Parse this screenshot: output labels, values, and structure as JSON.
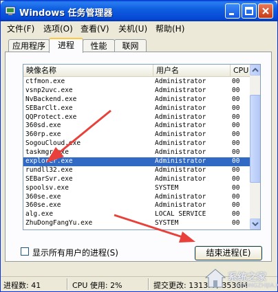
{
  "window": {
    "title": "Windows 任务管理器"
  },
  "menu": [
    "文件(F)",
    "选项(O)",
    "查看(V)",
    "关机(U)",
    "帮助(H)"
  ],
  "tabs": [
    "应用程序",
    "进程",
    "性能",
    "联网"
  ],
  "active_tab": "进程",
  "columns": [
    "映像名称",
    "用户名",
    "CPU"
  ],
  "processes": [
    {
      "name": "ctfmon.exe",
      "user": "Administrator",
      "cpu": "00"
    },
    {
      "name": "vsnp2uvc.exe",
      "user": "Administrator",
      "cpu": "00"
    },
    {
      "name": "NvBackend.exe",
      "user": "Administrator",
      "cpu": "00"
    },
    {
      "name": "SEBarClt.exe",
      "user": "Administrator",
      "cpu": "00"
    },
    {
      "name": "QQProtect.exe",
      "user": "Administrator",
      "cpu": "00"
    },
    {
      "name": "360sd.exe",
      "user": "Administrator",
      "cpu": "00"
    },
    {
      "name": "360rp.exe",
      "user": "Administrator",
      "cpu": "00"
    },
    {
      "name": "SogouCloud.exe",
      "user": "Administrator",
      "cpu": "00"
    },
    {
      "name": "taskmgr.exe",
      "user": "Administrator",
      "cpu": "00"
    },
    {
      "name": "explorer.exe",
      "user": "Administrator",
      "cpu": "00"
    },
    {
      "name": "rundll32.exe",
      "user": "Administrator",
      "cpu": "00"
    },
    {
      "name": "SEBarSvr.exe",
      "user": "Administrator",
      "cpu": "00"
    },
    {
      "name": "spoolsv.exe",
      "user": "SYSTEM",
      "cpu": "00"
    },
    {
      "name": "360se.exe",
      "user": "Administrator",
      "cpu": "00"
    },
    {
      "name": "360se.exe",
      "user": "Administrator",
      "cpu": "00"
    },
    {
      "name": "alg.exe",
      "user": "LOCAL SERVICE",
      "cpu": "00"
    },
    {
      "name": "ZhuDongFangYu.exe",
      "user": "SYSTEM",
      "cpu": "00"
    }
  ],
  "selected_process": "explorer.exe",
  "show_all_users_label": "显示所有用户的进程(S)",
  "end_process_label": "结束进程(E)",
  "status": {
    "process_count": "进程数: 41",
    "cpu_usage": "CPU 使用: 2%",
    "commit": "提交更改: 1313M / 3536M"
  },
  "watermark": {
    "text": "系统之家",
    "sub": "XITONGZHIJIA.NET"
  },
  "colors": {
    "titlebar": "#0548d4",
    "selection": "#316ac5",
    "arrow": "#e8413b"
  }
}
